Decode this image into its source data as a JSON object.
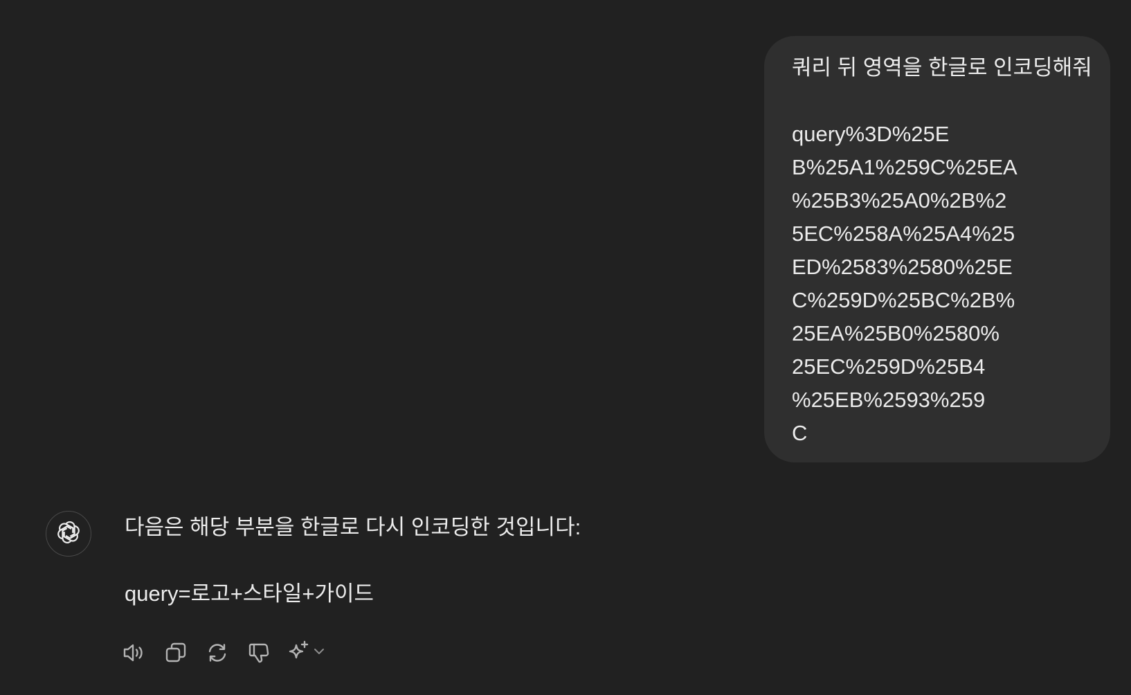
{
  "user_message": {
    "lines": [
      "쿼리 뒤 영역을 한글로 인코딩해줘",
      "",
      "query%3D%25E",
      "B%25A1%259C%25EA",
      "%25B3%25A0%2B%2",
      "5EC%258A%25A4%25",
      "ED%2583%2580%25E",
      "C%259D%25BC%2B%",
      "25EA%25B0%2580%",
      "25EC%259D%25B4",
      "%25EB%2593%259",
      "C"
    ]
  },
  "assistant_message": {
    "avatar_icon": "openai-logo-icon",
    "lines": [
      "다음은 해당 부분을 한글로 다시 인코딩한 것입니다:",
      "",
      "query=로고+스타일+가이드"
    ]
  },
  "actions": {
    "icons": [
      "speaker-icon",
      "copy-icon",
      "regenerate-icon",
      "thumbs-down-icon",
      "sparkle-icon",
      "chevron-down-icon"
    ]
  },
  "colors": {
    "background": "#212121",
    "user_bubble": "#2f2f2f",
    "text": "#ececec",
    "icon": "#b4b4b4"
  }
}
